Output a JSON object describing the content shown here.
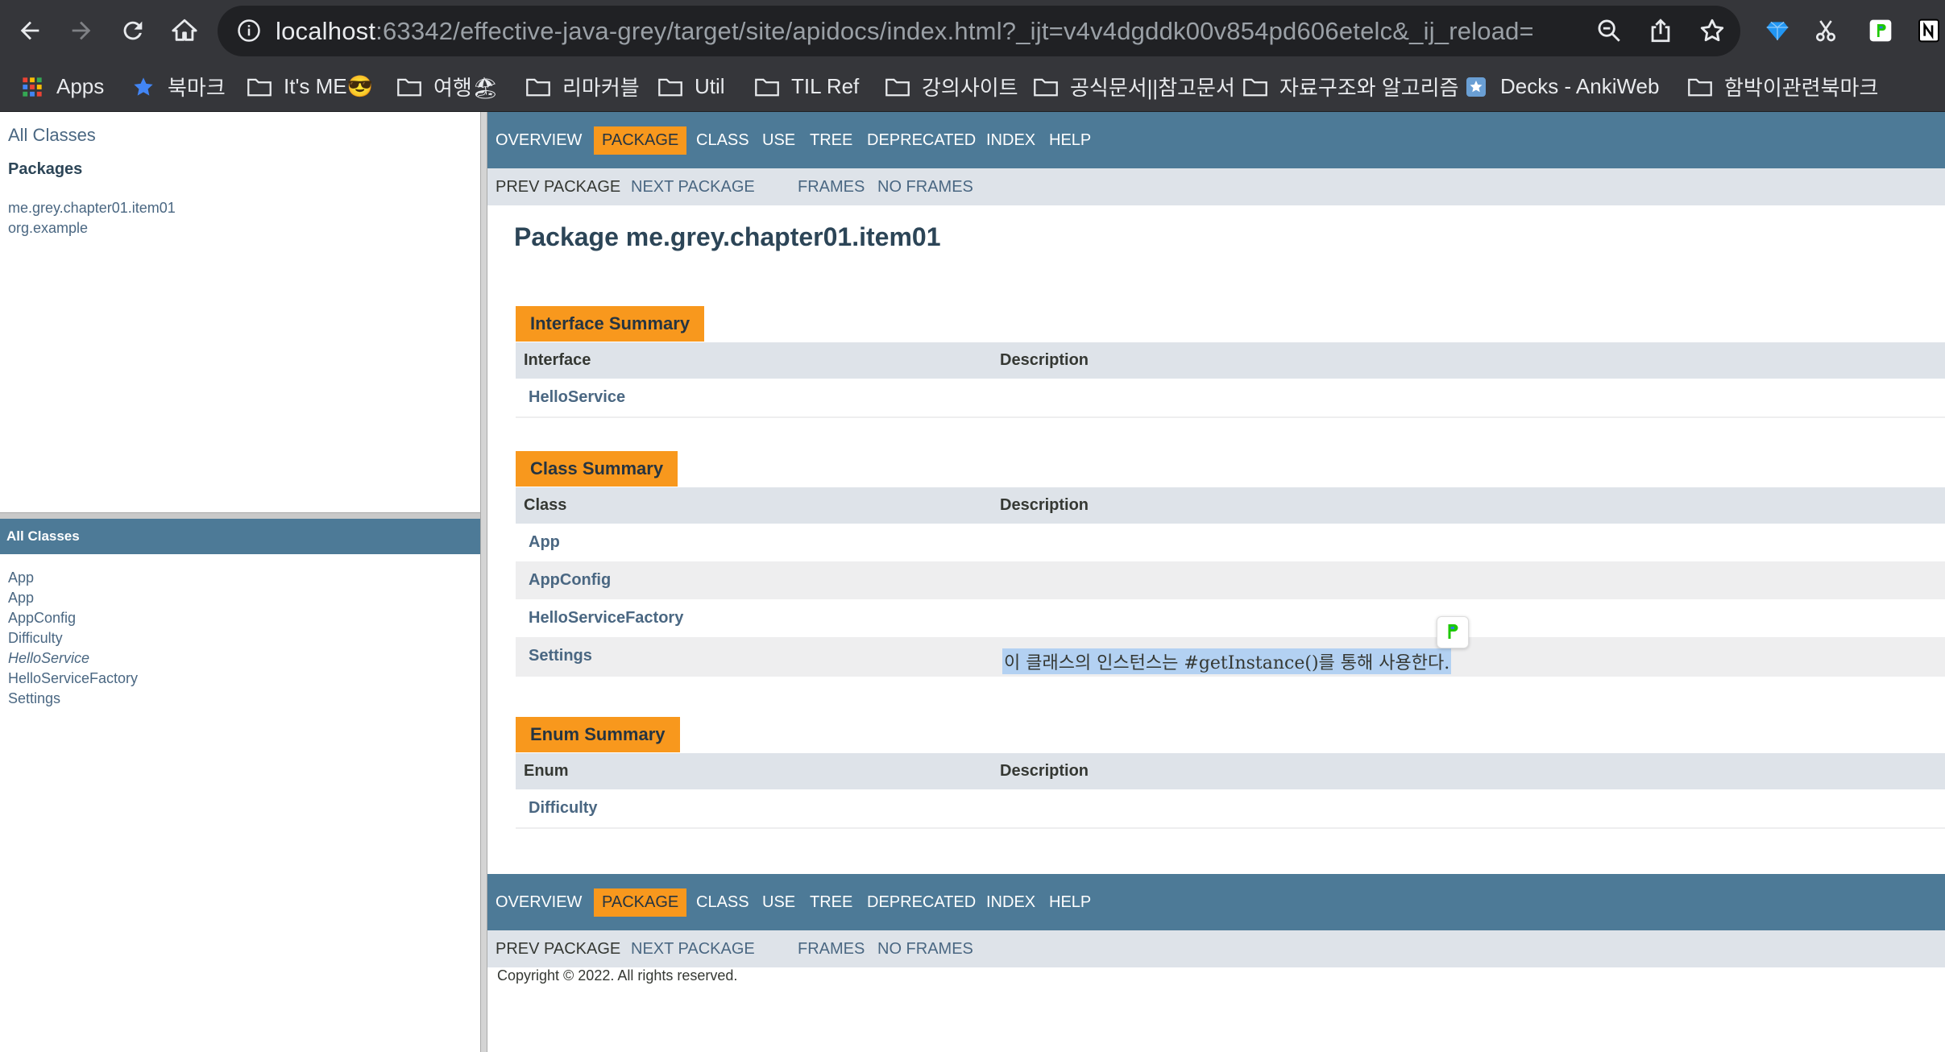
{
  "browser": {
    "url_host": "localhost",
    "url_rest": ":63342/effective-java-grey/target/site/apidocs/index.html?_ijt=v4v4dgddk00v854pd606etelc&_ij_reload=RELO...",
    "bookmarks": [
      {
        "label": "Apps",
        "icon": "apps-grid-icon"
      },
      {
        "label": "북마크",
        "icon": "star-icon"
      },
      {
        "label": "It's ME😎",
        "icon": "folder-icon"
      },
      {
        "label": "여행🏖",
        "icon": "folder-icon"
      },
      {
        "label": "리마커블",
        "icon": "folder-icon"
      },
      {
        "label": "Util",
        "icon": "folder-icon"
      },
      {
        "label": "TIL Ref",
        "icon": "folder-icon"
      },
      {
        "label": "강의사이트",
        "icon": "folder-icon"
      },
      {
        "label": "공식문서||참고문서",
        "icon": "folder-icon"
      },
      {
        "label": "자료구조와 알고리즘",
        "icon": "folder-icon"
      },
      {
        "label": "Decks - AnkiWeb",
        "icon": "anki-icon"
      },
      {
        "label": "함박이관련북마크",
        "icon": "folder-icon"
      }
    ]
  },
  "left_top": {
    "all_classes_link": "All Classes",
    "packages_title": "Packages",
    "packages": [
      "me.grey.chapter01.item01",
      "org.example"
    ]
  },
  "left_bottom": {
    "header": "All Classes",
    "classes": [
      "App",
      "App",
      "AppConfig",
      "Difficulty",
      "HelloService",
      "HelloServiceFactory",
      "Settings"
    ]
  },
  "navbar": {
    "overview": "OVERVIEW",
    "package": "PACKAGE",
    "class": "CLASS",
    "use": "USE",
    "tree": "TREE",
    "deprecated": "DEPRECATED",
    "index": "INDEX",
    "help": "HELP"
  },
  "subnav": {
    "prev_package": "PREV PACKAGE",
    "next_package": "NEXT PACKAGE",
    "frames": "FRAMES",
    "no_frames": "NO FRAMES"
  },
  "main": {
    "title": "Package me.grey.chapter01.item01",
    "interface_summary": {
      "caption": "Interface Summary",
      "col1": "Interface",
      "col2": "Description",
      "rows": [
        {
          "name": "HelloService",
          "desc": ""
        }
      ]
    },
    "class_summary": {
      "caption": "Class Summary",
      "col1": "Class",
      "col2": "Description",
      "rows": [
        {
          "name": "App",
          "desc": ""
        },
        {
          "name": "AppConfig",
          "desc": ""
        },
        {
          "name": "HelloServiceFactory",
          "desc": ""
        },
        {
          "name": "Settings",
          "desc": "이 클래스의 인스턴스는 #getInstance()를 통해 사용한다."
        }
      ]
    },
    "enum_summary": {
      "caption": "Enum Summary",
      "col1": "Enum",
      "col2": "Description",
      "rows": [
        {
          "name": "Difficulty",
          "desc": ""
        }
      ]
    },
    "copyright": "Copyright © 2022. All rights reserved."
  },
  "colors": {
    "nav_blue": "#4d7a97",
    "active_orange": "#f8981d",
    "link_blue": "#4a6782",
    "chrome_dark": "#35363a"
  }
}
